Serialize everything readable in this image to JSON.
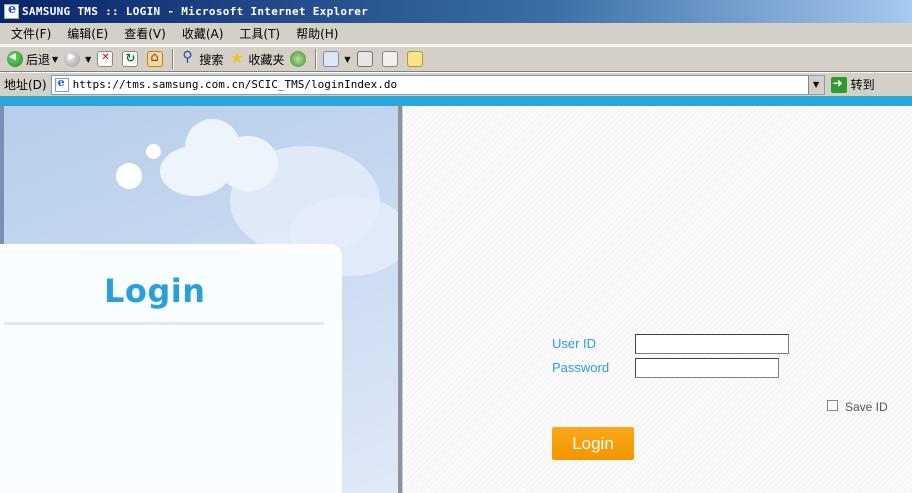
{
  "window": {
    "title": "SAMSUNG TMS :: LOGIN - Microsoft Internet Explorer"
  },
  "menu": [
    {
      "label": "文件(F)"
    },
    {
      "label": "编辑(E)"
    },
    {
      "label": "查看(V)"
    },
    {
      "label": "收藏(A)"
    },
    {
      "label": "工具(T)"
    },
    {
      "label": "帮助(H)"
    }
  ],
  "toolbar": {
    "back_label": "后退",
    "search_label": "搜索",
    "favorites_label": "收藏夹"
  },
  "address": {
    "label": "地址(D)",
    "url": "https://tms.samsung.com.cn/SCIC_TMS/loginIndex.do",
    "go_label": "转到"
  },
  "page": {
    "heading": "Login",
    "user_id_label": "User ID",
    "user_id_value": "",
    "password_label": "Password",
    "password_value": "",
    "save_id_label": "Save ID",
    "save_id_checked": false,
    "login_button": "Login"
  },
  "colors": {
    "accent_blue": "#2aa0d8",
    "login_orange": "#f39500",
    "top_strip": "#2aa7d6"
  }
}
